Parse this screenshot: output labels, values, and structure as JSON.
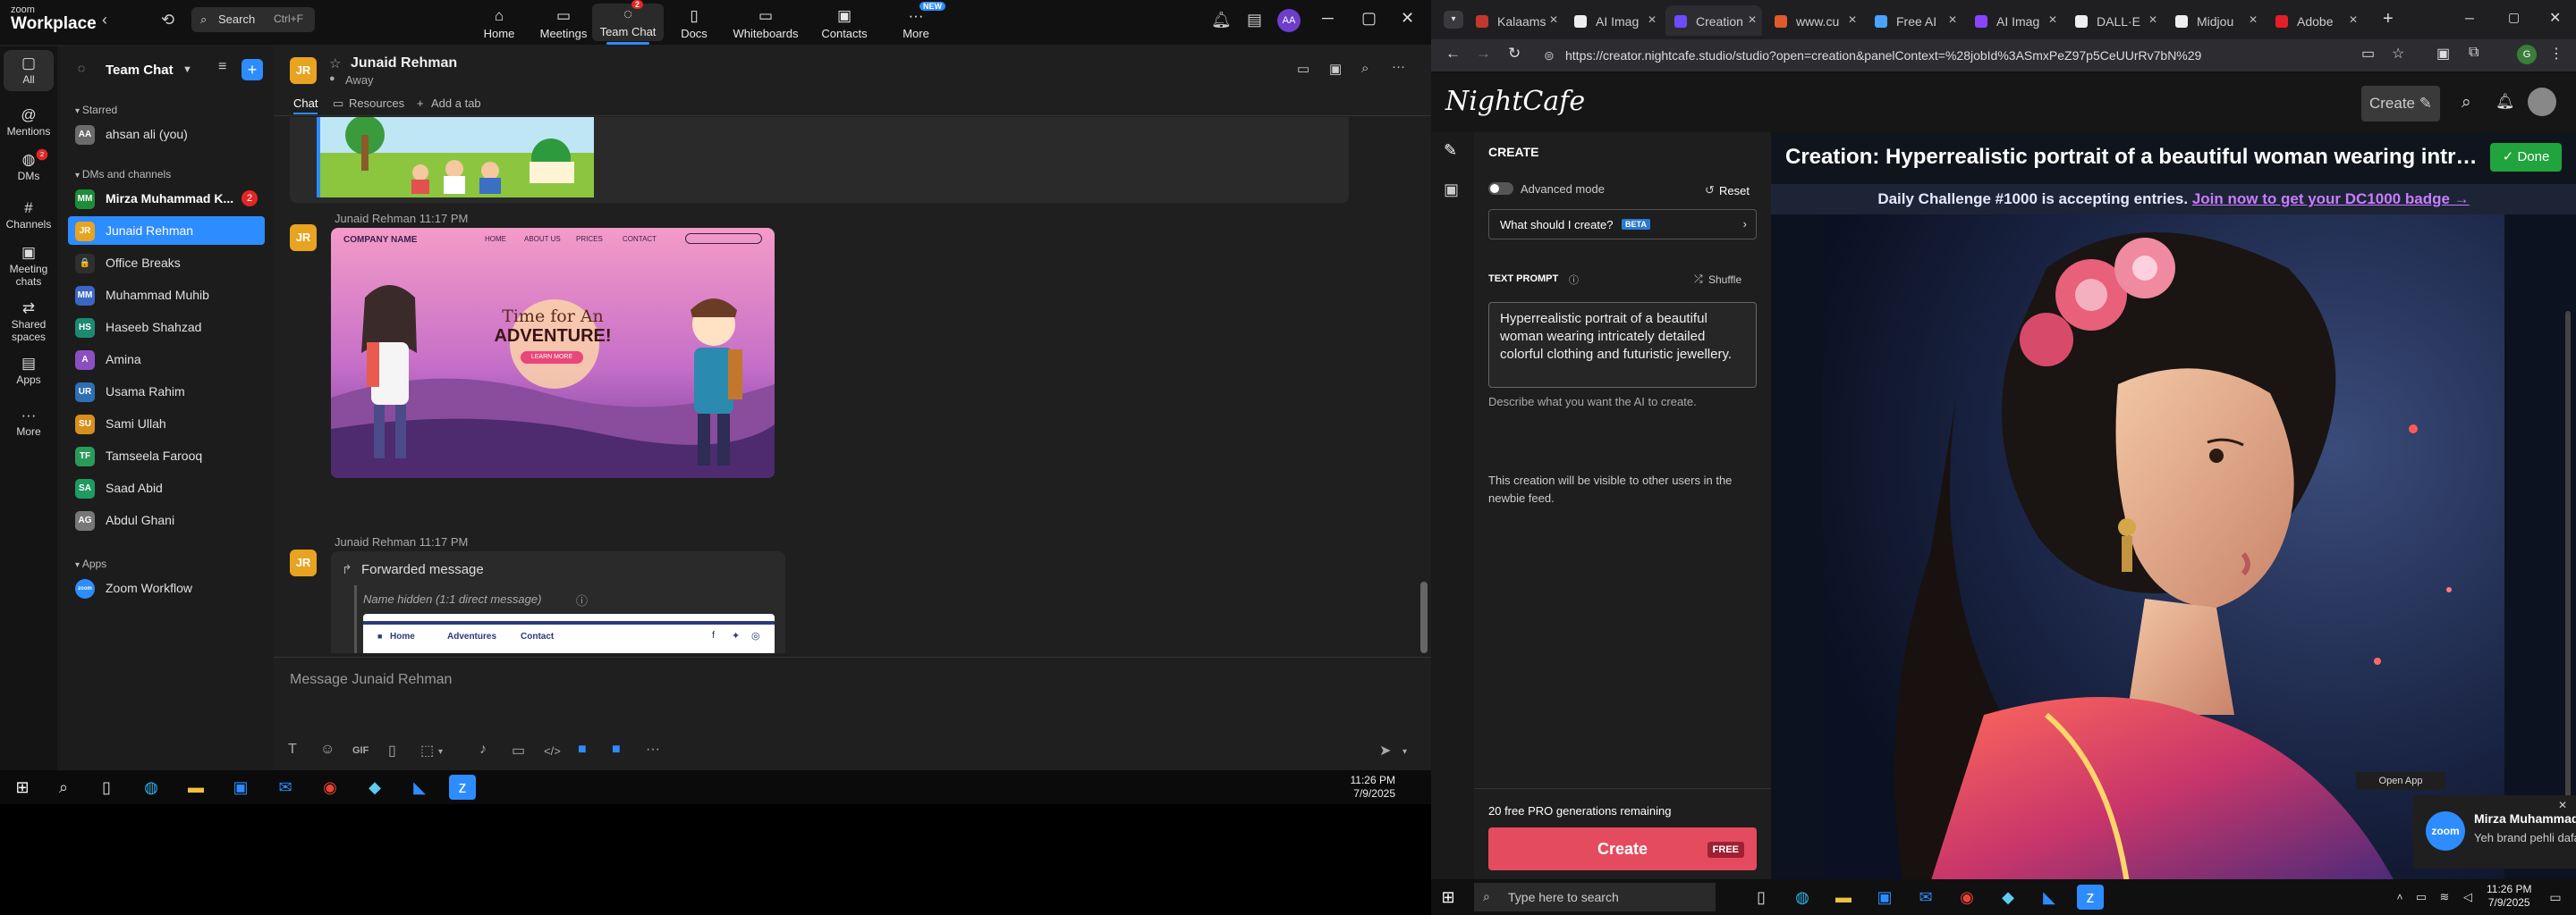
{
  "zoom": {
    "logo_small": "zoom",
    "logo_big": "Workplace",
    "search": {
      "placeholder": "Search",
      "shortcut": "Ctrl+F"
    },
    "nav": [
      {
        "label": "Home",
        "icon": "home-icon",
        "glyph": "⌂"
      },
      {
        "label": "Meetings",
        "icon": "video-camera-icon",
        "glyph": "▭"
      },
      {
        "label": "Team Chat",
        "icon": "chat-icon",
        "glyph": "◌",
        "badge": "2"
      },
      {
        "label": "Docs",
        "icon": "document-icon",
        "glyph": "▯"
      },
      {
        "label": "Whiteboards",
        "icon": "whiteboard-icon",
        "glyph": "▭"
      },
      {
        "label": "Contacts",
        "icon": "contacts-icon",
        "glyph": "▣"
      },
      {
        "label": "More",
        "icon": "more-icon",
        "glyph": "···",
        "badge": "NEW"
      }
    ],
    "rail": [
      {
        "label": "All",
        "glyph": "▢"
      },
      {
        "label": "Mentions",
        "glyph": "@"
      },
      {
        "label": "DMs",
        "glyph": "◍",
        "badge": "2"
      },
      {
        "label": "Channels",
        "glyph": "#"
      },
      {
        "label": "Meeting chats",
        "glyph": "▣"
      },
      {
        "label": "Shared spaces",
        "glyph": "⇄"
      },
      {
        "label": "Apps",
        "glyph": "▤"
      },
      {
        "label": "More",
        "glyph": "···"
      }
    ],
    "sidebar": {
      "title": "Team Chat",
      "starred_label": "Starred",
      "starred": [
        {
          "name": "ahsan ali (you)",
          "initials": "AA",
          "color": "#6b6b6b"
        }
      ],
      "dms_label": "DMs and channels",
      "items": [
        {
          "name": "Mirza Muhammad K...",
          "initials": "MM",
          "color": "#1e8c3a",
          "count": "2",
          "bold": true
        },
        {
          "name": "Junaid Rehman",
          "initials": "JR",
          "color": "#e8a321",
          "selected": true
        },
        {
          "name": "Office Breaks",
          "initials": "🔒",
          "color": "#2f2f2f"
        },
        {
          "name": "Muhammad Muhib",
          "initials": "MM",
          "color": "#3b66c4"
        },
        {
          "name": "Haseeb Shahzad",
          "initials": "HS",
          "color": "#1c8a6f"
        },
        {
          "name": "Amina",
          "initials": "A",
          "color": "#8b4fc2"
        },
        {
          "name": "Usama Rahim",
          "initials": "UR",
          "color": "#2d6fb3"
        },
        {
          "name": "Sami Ullah",
          "initials": "SU",
          "color": "#d88f1e"
        },
        {
          "name": "Tamseela Farooq",
          "initials": "TF",
          "color": "#2a9a5b"
        },
        {
          "name": "Saad Abid",
          "initials": "SA",
          "color": "#1f9b62"
        },
        {
          "name": "Abdul Ghani",
          "initials": "AG",
          "color": "#777777"
        }
      ],
      "apps_label": "Apps",
      "apps": [
        {
          "name": "Zoom Workflow",
          "initials": "zoom",
          "color": "#2d8cff"
        }
      ]
    },
    "chat": {
      "contact_name": "Junaid Rehman",
      "contact_initials": "JR",
      "status": "Away",
      "tabs": [
        "Chat",
        "Resources",
        "Add a tab"
      ],
      "messages": [
        {
          "sender": "Junaid Rehman",
          "time": "11:17 PM",
          "kind": "image",
          "image": "Time for an Adventure banner",
          "banner": {
            "brand": "COMPANY NAME",
            "links": [
              "HOME",
              "ABOUT US",
              "PRICES",
              "CONTACT"
            ],
            "line1": "Time for An",
            "line2": "ADVENTURE!",
            "button": "LEARN MORE"
          }
        },
        {
          "sender": "Junaid Rehman",
          "time": "11:17 PM",
          "kind": "forward",
          "forward_label": "Forwarded message",
          "hidden_note": "Name hidden (1:1 direct message)",
          "preview_links": [
            "Home",
            "Adventures",
            "Contact"
          ]
        }
      ],
      "compose_placeholder": "Message Junaid Rehman"
    },
    "taskbar": {
      "time": "11:26 PM",
      "date": "7/9/2025"
    }
  },
  "browser": {
    "tabs": [
      {
        "label": "Kalaams",
        "color": "#c0392b"
      },
      {
        "label": "AI Imag",
        "color": "#eee"
      },
      {
        "label": "Creation",
        "color": "#6d4cff",
        "active": true
      },
      {
        "label": "www.cu",
        "color": "#e05a2a"
      },
      {
        "label": "Free AI",
        "color": "#4aa3ff"
      },
      {
        "label": "AI Imag",
        "color": "#8a44ff"
      },
      {
        "label": "DALL·E",
        "color": "#eee"
      },
      {
        "label": "Midjou",
        "color": "#eee"
      },
      {
        "label": "Adobe",
        "color": "#e21f26"
      }
    ],
    "url": "https://creator.nightcafe.studio/studio?open=creation&panelContext=%28jobId%3ASmxPeZ97p5CeUUrRv7bN%29"
  },
  "nightcafe": {
    "logo": "NightCafe",
    "create_button": "Create",
    "panel_header": "CREATE",
    "advanced_mode": "Advanced mode",
    "reset": "Reset",
    "what_create": "What should I create?",
    "beta": "BETA",
    "text_prompt_label": "TEXT PROMPT",
    "shuffle": "Shuffle",
    "prompt": "Hyperrealistic portrait of a beautiful woman wearing intricately detailed colorful clothing and futuristic jewellery.",
    "prompt_hint": "Describe what you want the AI to create.",
    "visibility_note": "This creation will be visible to other users in the newbie feed.",
    "remaining": "20 free PRO generations remaining",
    "create_cta": "Create",
    "free": "FREE",
    "creation_title": "Creation: Hyperrealistic portrait of a beautiful woman wearing intricately ...",
    "done": "Done",
    "daily_text": "Daily Challenge #1000 is accepting entries.",
    "daily_link": "Join now to get your DC1000 badge →"
  },
  "notification": {
    "open_app": "Open App",
    "app": "zoom",
    "sender": "Mirza Muhammad Khurram",
    "message": "Yeh brand pehli dafa suna hai"
  },
  "windows_taskbar": {
    "search_placeholder": "Type here to search",
    "time": "11:26 PM",
    "date": "7/9/2025"
  }
}
